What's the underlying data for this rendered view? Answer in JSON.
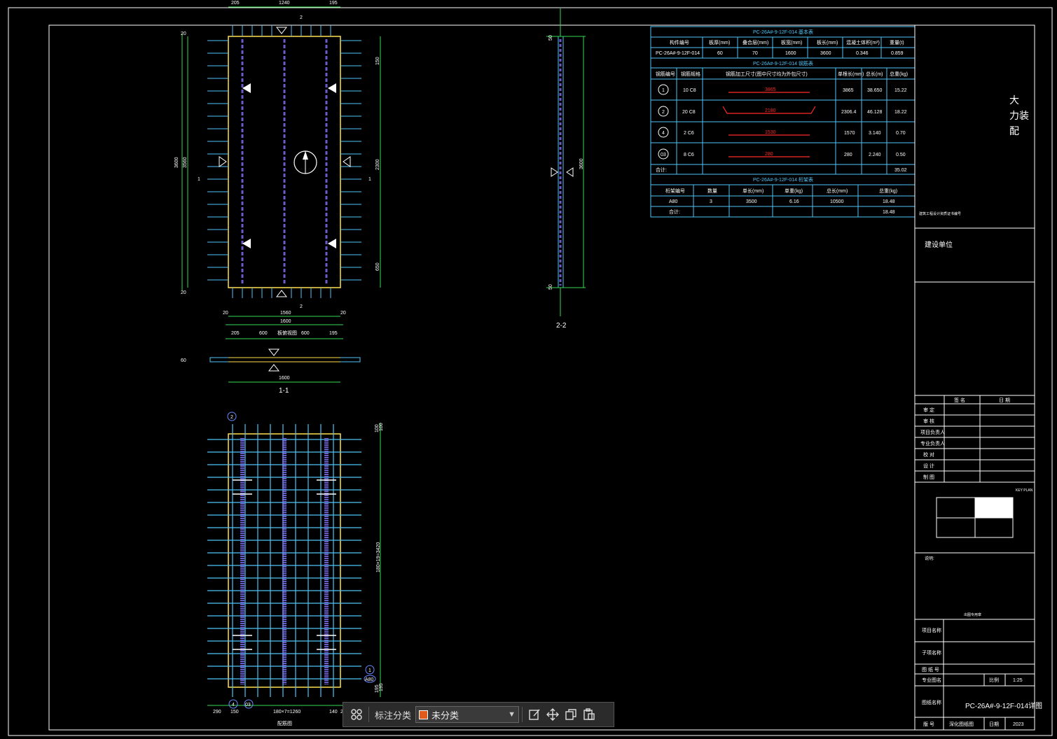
{
  "drawing": {
    "top_dims": [
      "205",
      "1240",
      "195"
    ],
    "top_section_marker": "2",
    "side_dims_left": [
      "20",
      "3600",
      "3560",
      "20"
    ],
    "side_dims_right": [
      "150",
      "2300",
      "650"
    ],
    "section_marker_left": "1",
    "section_marker_right": "1",
    "bottom_dims_a": [
      "20",
      "1560",
      "20"
    ],
    "bottom_dim_total": "1600",
    "top_view_label": "板俯视图",
    "sec11_dims": [
      "205",
      "600",
      "600",
      "195"
    ],
    "sec11_thickness": "60",
    "sec11_width": "1600",
    "sec11_label": "1-1",
    "sec22_label": "2-2",
    "sec22_dims": [
      "50",
      "3600",
      "50"
    ],
    "rebar_marker_2": "2",
    "rebar_marker_1": "1",
    "rebar_marker_4": "4",
    "rebar_marker_03": "03",
    "rebar_marker_a80": "A80",
    "rebar_right_dims": [
      "100",
      "100",
      "180×19=3420",
      "195",
      "195"
    ],
    "rebar_bottom_dims": [
      "290",
      "150",
      "180×7=1260",
      "140",
      "205"
    ],
    "rebar_view_label": "配筋图"
  },
  "table1": {
    "title": "PC-26A#-9-12F-014 基本表",
    "headers": [
      "构件编号",
      "板厚(mm)",
      "叠合层(mm)",
      "板宽(mm)",
      "板长(mm)",
      "混凝土体积(m³)",
      "重量(t)"
    ],
    "row": [
      "PC-26A#-9-12F-014",
      "60",
      "70",
      "1600",
      "3600",
      "0.346",
      "0.859"
    ]
  },
  "table2": {
    "title": "PC-26A#-9-12F-014 钢筋表",
    "headers": [
      "钢筋编号",
      "钢筋规格",
      "钢筋加工尺寸(图中尺寸均为外包尺寸)",
      "单根长(mm)",
      "总长(m)",
      "总重(kg)"
    ],
    "rows": [
      {
        "no": "1",
        "spec": "10 C8",
        "len": "3865",
        "single": "3865",
        "total": "38.650",
        "weight": "15.22"
      },
      {
        "no": "2",
        "spec": "20 C8",
        "len": "2180",
        "single": "2306.4",
        "total": "46.128",
        "weight": "18.22"
      },
      {
        "no": "4",
        "spec": "2 C6",
        "len": "1530",
        "single": "1570",
        "total": "3.140",
        "weight": "0.70"
      },
      {
        "no": "03",
        "spec": "8 C6",
        "len": "280",
        "single": "280",
        "total": "2.240",
        "weight": "0.50"
      }
    ],
    "sum_label": "合计:",
    "sum_value": "35.02"
  },
  "table3": {
    "title": "PC-26A#-9-12F-014 桁架表",
    "headers": [
      "桁架编号",
      "数量",
      "单长(mm)",
      "单重(kg)",
      "总长(mm)",
      "总重(kg)"
    ],
    "row": [
      "A80",
      "3",
      "3500",
      "6.16",
      "10500",
      "18.48"
    ],
    "sum_label": "合计:",
    "sum_value": "18.48"
  },
  "titleblock": {
    "company_chars": [
      "大",
      "力装",
      "配"
    ],
    "company_note": "建筑工程设计资质证书编号",
    "client_label": "建设单位",
    "sign_head": [
      "签 名",
      "日 期"
    ],
    "sign_rows": [
      "审 定",
      "审 核",
      "项目负责人",
      "专业负责人",
      "校 对",
      "设 计",
      "制 图"
    ],
    "keyplan_label": "KEY PLAN",
    "notes_label": "说明:",
    "stamp_label": "出图专用章",
    "project_label": "项目名称",
    "subitem_label": "子项名称",
    "drawing_no_label": "图 纸 号",
    "scale_label": "专业图名",
    "scale_key": "比例",
    "scale_value": "1:25",
    "drawing_name_label": "图纸名称",
    "drawing_name": "PC-26A#-9-12F-014详图",
    "no_label": "版 号",
    "no_value": "深化图纸图",
    "date_label": "日期",
    "date_value": "2023"
  },
  "toolbar": {
    "category_label": "标注分类",
    "category_value": "未分类"
  }
}
